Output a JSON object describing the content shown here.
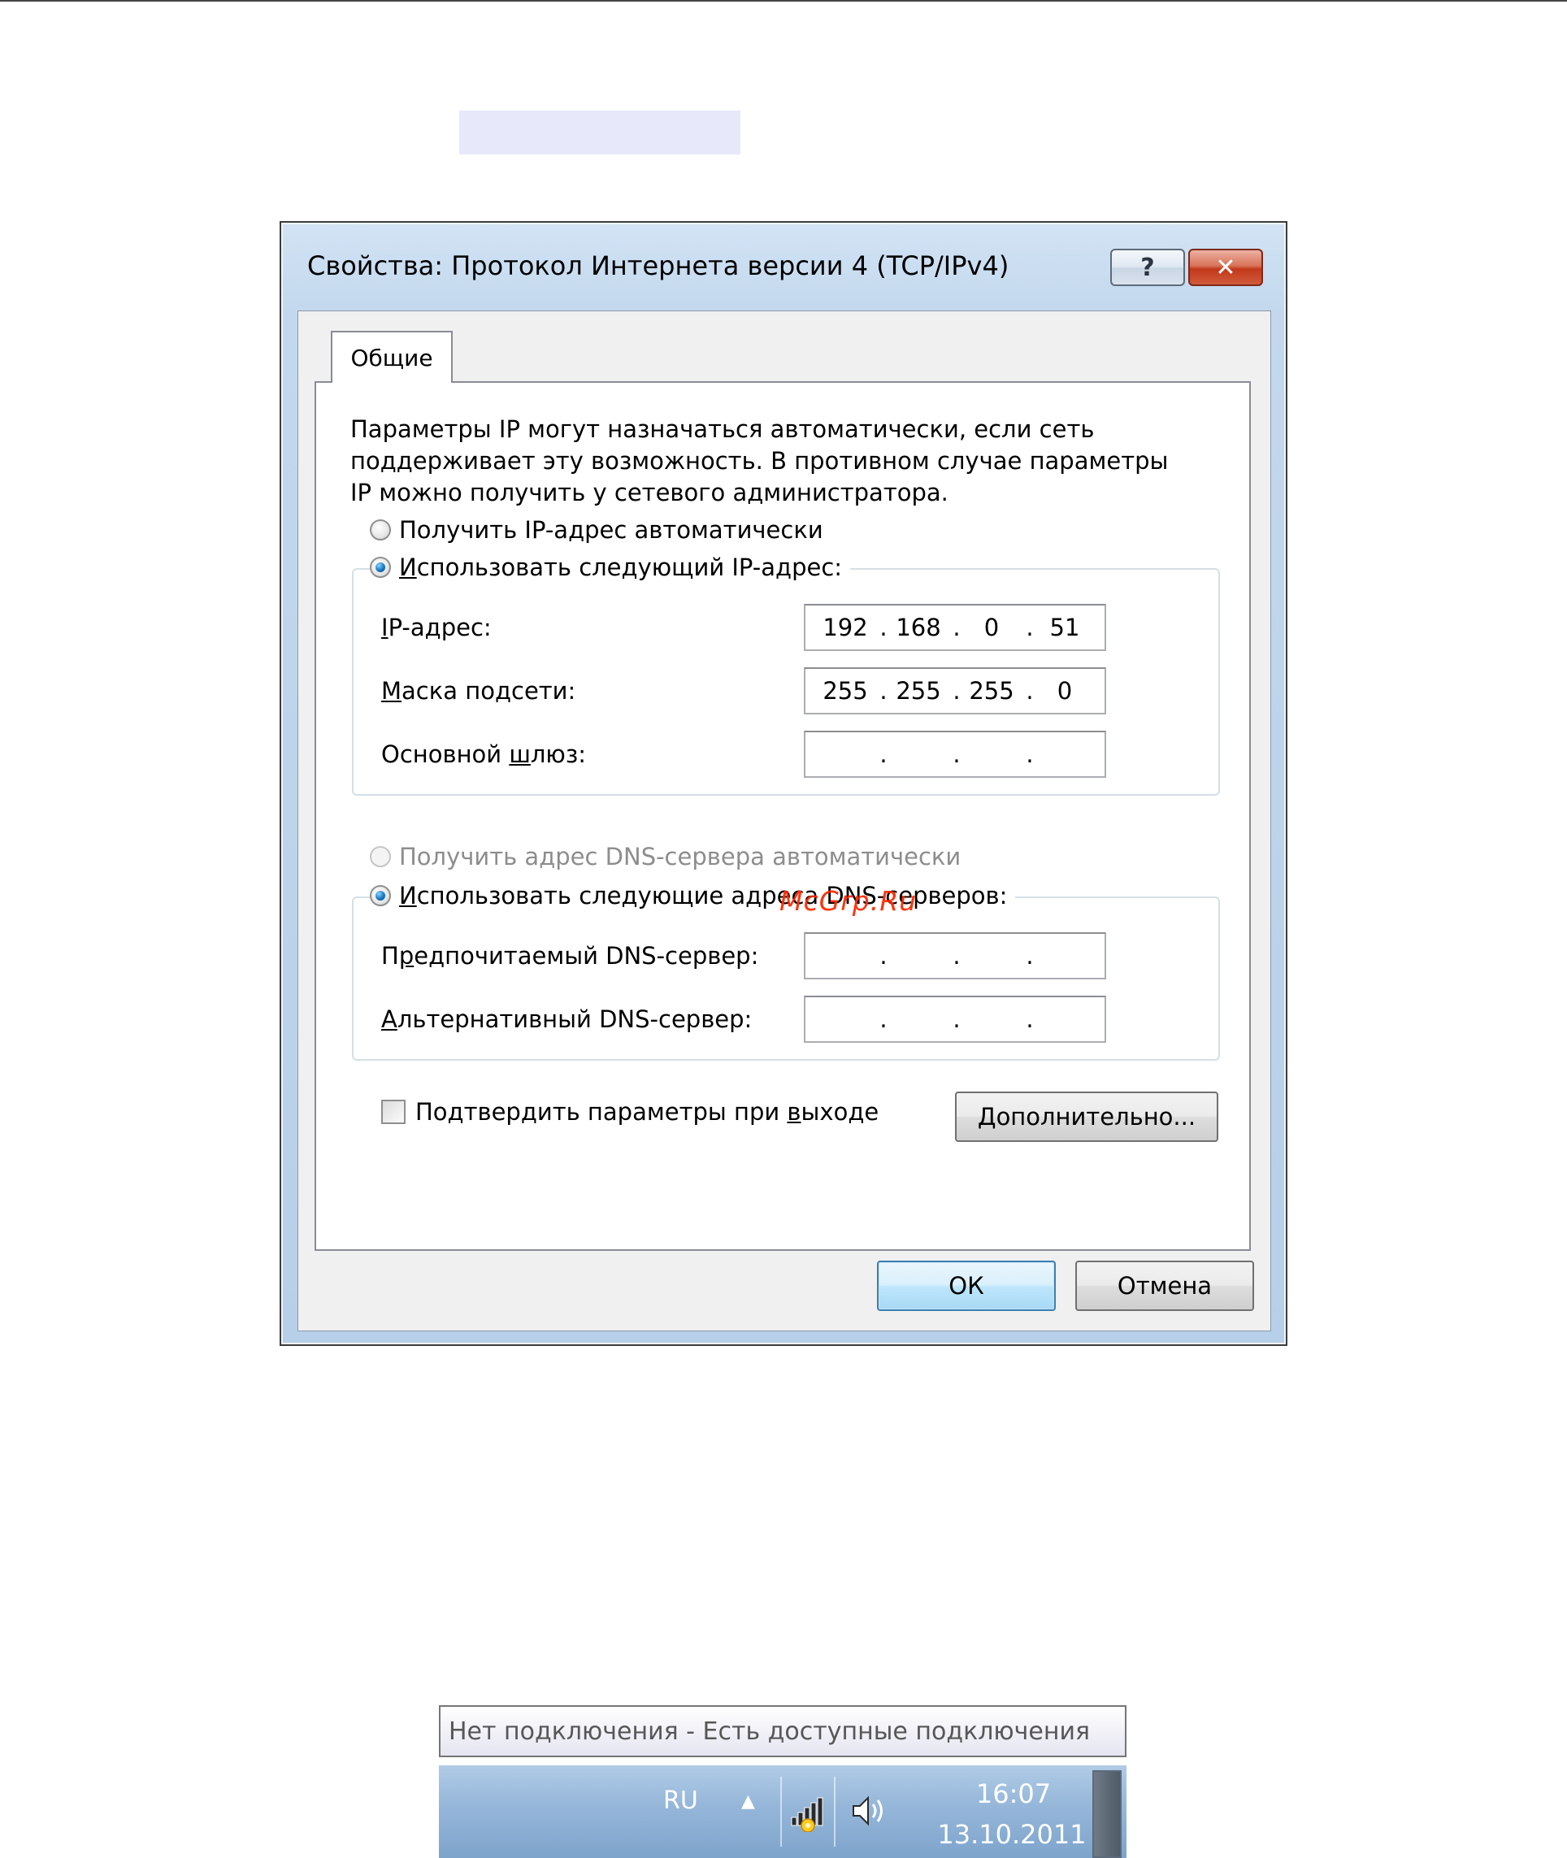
{
  "dialog": {
    "title": "Свойства: Протокол Интернета версии 4 (TCP/IPv4)",
    "help_glyph": "?",
    "close_glyph": "✕",
    "tab_label": "Общие",
    "description": "Параметры IP могут назначаться автоматически, если сеть\nподдерживает эту возможность. В противном случае параметры\nIP можно получить у сетевого администратора.",
    "ip_auto": {
      "label": "Получить IP-адрес автоматически",
      "checked": false
    },
    "ip_manual": {
      "prefix": "И",
      "label_rest": "спользовать следующий IP-адрес:",
      "checked": true
    },
    "fields": {
      "ip_address": {
        "label_ul": "I",
        "label_rest": "P-адрес:",
        "octets": [
          "192",
          "168",
          "0",
          "51"
        ]
      },
      "subnet_mask": {
        "label_ul": "М",
        "label_rest": "аска подсети:",
        "octets": [
          "255",
          "255",
          "255",
          "0"
        ]
      },
      "gateway": {
        "label_pre": "Основной ",
        "label_ul": "ш",
        "label_rest": "люз:",
        "octets": [
          "",
          "",
          "",
          ""
        ]
      }
    },
    "dns_auto": {
      "label": "Получить адрес DNS-сервера автоматически",
      "checked": false,
      "disabled": true
    },
    "dns_manual": {
      "prefix": "И",
      "label_rest": "спользовать следующие адреса DNS-серверов:",
      "checked": true
    },
    "dns_fields": {
      "preferred": {
        "label_pre": "П",
        "label_ul": "р",
        "label_rest": "едпочитаемый DNS-сервер:",
        "octets": [
          "",
          "",
          "",
          ""
        ]
      },
      "alternate": {
        "label_ul": "А",
        "label_rest": "льтернативный DNS-сервер:",
        "octets": [
          "",
          "",
          "",
          ""
        ]
      }
    },
    "validate_on_exit": {
      "label_pre": "Подтвердить параметры при ",
      "label_ul": "в",
      "label_rest": "ыходе",
      "checked": false
    },
    "advanced_button": {
      "label_ul": "Д",
      "label_rest": "ополнительно..."
    },
    "ok_button": "ОК",
    "cancel_button": "Отмена"
  },
  "watermark": "McGrp.Ru",
  "taskbar": {
    "tooltip": "Нет подключения - Есть доступные подключения",
    "language": "RU",
    "chevron": "▲",
    "time": "16:07",
    "date": "13.10.2011"
  }
}
